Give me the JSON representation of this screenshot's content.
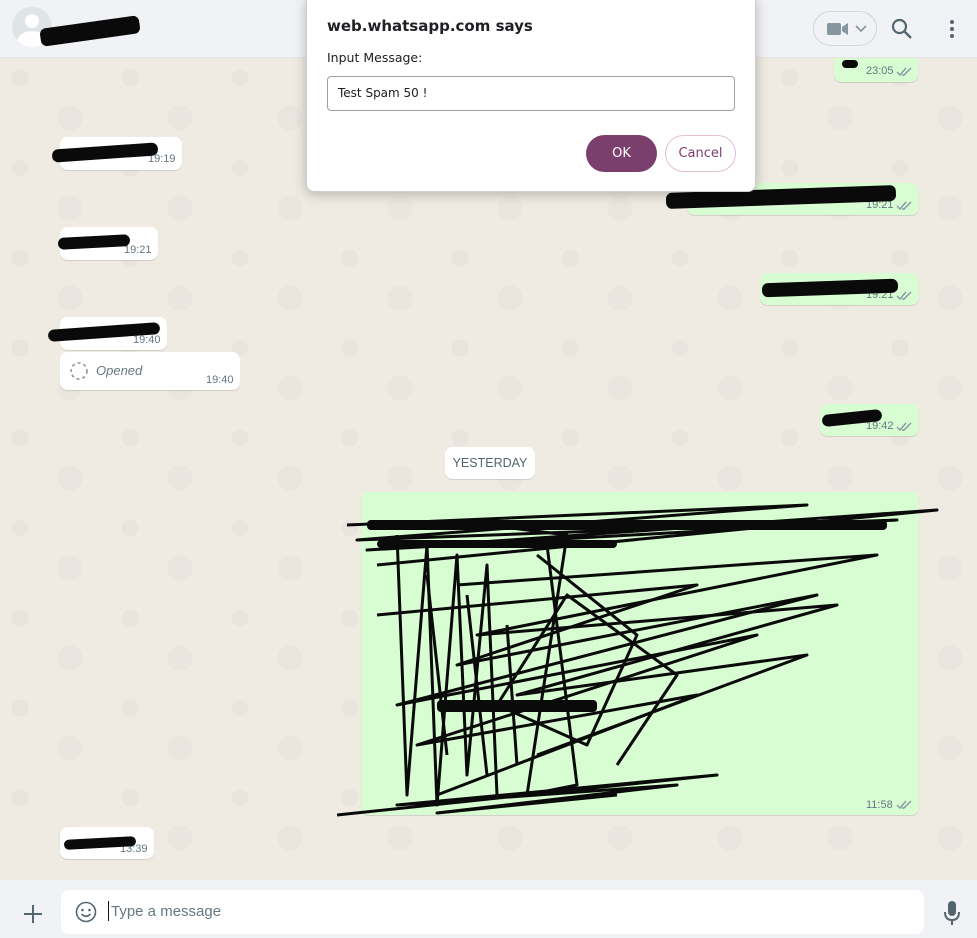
{
  "header": {
    "contact_name": "",
    "video_icon": "video-camera-icon",
    "search_icon": "search-icon",
    "menu_icon": "kebab-menu-icon"
  },
  "dialog": {
    "title": "web.whatsapp.com says",
    "label": "Input Message:",
    "input_value": "Test Spam 50 !",
    "ok_label": "OK",
    "cancel_label": "Cancel"
  },
  "messages": [
    {
      "side": "out",
      "time": "23:05",
      "ticks": true
    },
    {
      "side": "in",
      "time": "19:19"
    },
    {
      "side": "out",
      "time": "19:21",
      "ticks": true
    },
    {
      "side": "in",
      "time": "19:21"
    },
    {
      "side": "out",
      "time": "19:21",
      "ticks": true
    },
    {
      "side": "in",
      "time": "19:40"
    },
    {
      "side": "in",
      "time": "19:40",
      "text": "Opened"
    },
    {
      "side": "out",
      "time": "19:42",
      "ticks": true
    },
    {
      "side": "out",
      "time": "11:58",
      "ticks": true
    },
    {
      "side": "in",
      "time": "13:39"
    }
  ],
  "day_separator": "YESTERDAY",
  "footer": {
    "plus_icon": "plus-icon",
    "emoji_icon": "emoji-icon",
    "placeholder": "Type a message",
    "mic_icon": "microphone-icon"
  },
  "colors": {
    "header_bg": "#f0f2f5",
    "chat_bg": "#efeae2",
    "out_bubble": "#d9fdd3",
    "in_bubble": "#ffffff",
    "dialog_accent": "#7b3f6e"
  }
}
